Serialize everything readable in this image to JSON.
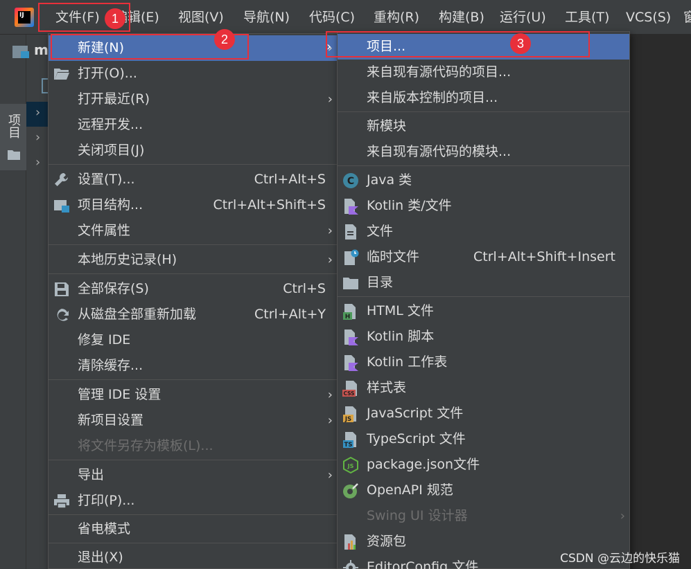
{
  "menubar": {
    "logo_text": "IJ",
    "items": [
      {
        "label": "文件(F)"
      },
      {
        "label": "编辑(E)"
      },
      {
        "label": "视图(V)"
      },
      {
        "label": "导航(N)"
      },
      {
        "label": "代码(C)"
      },
      {
        "label": "重构(R)"
      },
      {
        "label": "构建(B)"
      },
      {
        "label": "运行(U)"
      },
      {
        "label": "工具(T)"
      },
      {
        "label": "VCS(S)"
      },
      {
        "label": "窗"
      }
    ]
  },
  "tool_strip": {
    "project_label": "项目"
  },
  "nav": {
    "project_initial": "m"
  },
  "file_menu": {
    "items": [
      {
        "label": "新建(N)",
        "submenu": true,
        "selected": true
      },
      {
        "label": "打开(O)...",
        "icon": "folder-open-icon"
      },
      {
        "label": "打开最近(R)",
        "submenu": true
      },
      {
        "label": "远程开发..."
      },
      {
        "label": "关闭项目(J)"
      },
      {
        "label": "设置(T)...",
        "shortcut": "Ctrl+Alt+S",
        "icon": "wrench-icon"
      },
      {
        "label": "项目结构...",
        "shortcut": "Ctrl+Alt+Shift+S",
        "icon": "project-structure-icon"
      },
      {
        "label": "文件属性",
        "submenu": true
      },
      {
        "label": "本地历史记录(H)",
        "submenu": true
      },
      {
        "label": "全部保存(S)",
        "shortcut": "Ctrl+S",
        "icon": "save-icon"
      },
      {
        "label": "从磁盘全部重新加载",
        "shortcut": "Ctrl+Alt+Y",
        "icon": "reload-icon"
      },
      {
        "label": "修复 IDE"
      },
      {
        "label": "清除缓存..."
      },
      {
        "label": "管理 IDE 设置",
        "submenu": true
      },
      {
        "label": "新项目设置",
        "submenu": true
      },
      {
        "label": "将文件另存为模板(L)...",
        "disabled": true
      },
      {
        "label": "导出",
        "submenu": true
      },
      {
        "label": "打印(P)...",
        "icon": "printer-icon"
      },
      {
        "label": "省电模式"
      },
      {
        "label": "退出(X)"
      }
    ]
  },
  "new_menu": {
    "items": [
      {
        "label": "项目...",
        "selected": true
      },
      {
        "label": "来自现有源代码的项目..."
      },
      {
        "label": "来自版本控制的项目..."
      },
      {
        "label": "新模块"
      },
      {
        "label": "来自现有源代码的模块..."
      },
      {
        "label": "Java 类",
        "icon": "java-class-icon",
        "icon_text": "C"
      },
      {
        "label": "Kotlin 类/文件",
        "icon": "kotlin-file-icon"
      },
      {
        "label": "文件",
        "icon": "file-icon"
      },
      {
        "label": "临时文件",
        "shortcut": "Ctrl+Alt+Shift+Insert",
        "icon": "scratch-file-icon"
      },
      {
        "label": "目录",
        "icon": "directory-icon"
      },
      {
        "label": "HTML 文件",
        "icon": "html-file-icon",
        "icon_text": "H"
      },
      {
        "label": "Kotlin 脚本",
        "icon": "kotlin-script-icon"
      },
      {
        "label": "Kotlin 工作表",
        "icon": "kotlin-worksheet-icon"
      },
      {
        "label": "样式表",
        "icon": "css-file-icon",
        "icon_text": "CSS"
      },
      {
        "label": "JavaScript 文件",
        "icon": "javascript-file-icon",
        "icon_text": "JS"
      },
      {
        "label": "TypeScript 文件",
        "icon": "typescript-file-icon",
        "icon_text": "TS"
      },
      {
        "label": "package.json文件",
        "icon": "nodejs-icon",
        "icon_text": "JS"
      },
      {
        "label": "OpenAPI 规范",
        "icon": "openapi-icon"
      },
      {
        "label": "Swing UI 设计器",
        "submenu": true,
        "disabled": true
      },
      {
        "label": "资源包",
        "icon": "resource-bundle-icon"
      },
      {
        "label": "EditorConfig 文件",
        "icon": "gear-icon"
      }
    ]
  },
  "annotations": {
    "badge1": "1",
    "badge2": "2",
    "badge3": "3"
  },
  "watermark": "CSDN @云边的快乐猫",
  "colors": {
    "background": "#2b2b2b",
    "menu": "#3c3f41",
    "selection": "#4b6eaf",
    "annotation": "#e8303a"
  }
}
